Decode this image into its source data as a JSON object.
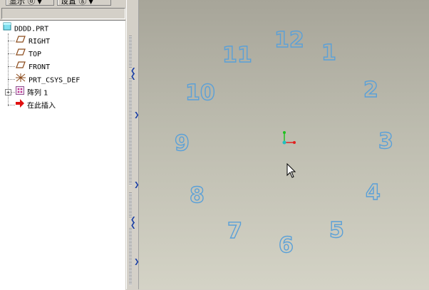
{
  "toolbar": {
    "display_menu": "显示 ⓓ",
    "settings_menu": "设置 ⓖ"
  },
  "model_tree": {
    "root": "DDDD.PRT",
    "items": [
      {
        "label": "RIGHT",
        "icon": "datum-plane-icon"
      },
      {
        "label": "TOP",
        "icon": "datum-plane-icon"
      },
      {
        "label": "FRONT",
        "icon": "datum-plane-icon"
      },
      {
        "label": "PRT_CSYS_DEF",
        "icon": "coordinate-system-icon"
      },
      {
        "label": "阵列 1",
        "icon": "pattern-icon"
      },
      {
        "label": "在此插入",
        "icon": "insert-here-arrow-icon"
      }
    ]
  },
  "clock_numbers": [
    "12",
    "1",
    "2",
    "3",
    "4",
    "5",
    "6",
    "7",
    "8",
    "9",
    "10",
    "11"
  ],
  "colors": {
    "number_outline": "#5aa0d8",
    "background_top": "#a7a599",
    "background_bottom": "#d4d3c6",
    "csys_x": "#e02020",
    "csys_y": "#20c020",
    "csys_z": "#20c0c0"
  }
}
